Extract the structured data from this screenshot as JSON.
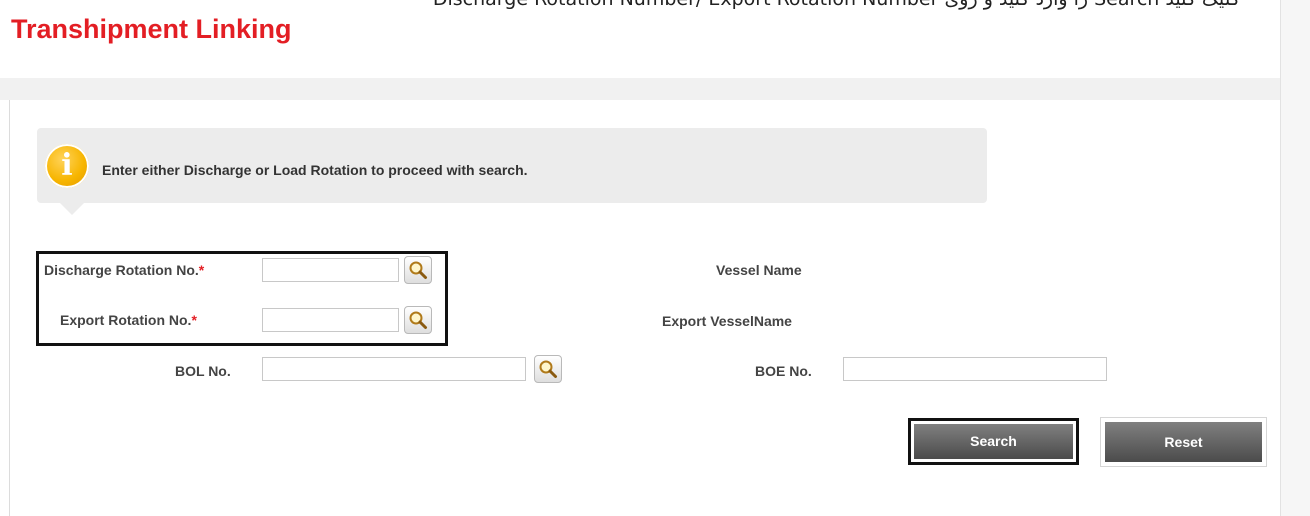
{
  "top_caption": "Discharge Rotation Number/ Export Rotation Number را وارد کنید و روی  Search کلیک کنید",
  "page_title": "Transhipment Linking",
  "info": {
    "icon": "info-icon",
    "icon_glyph": "i",
    "message": "Enter either Discharge or Load Rotation to proceed with search."
  },
  "form": {
    "discharge_rotation": {
      "label": "Discharge Rotation No.",
      "required_mark": "*",
      "value": ""
    },
    "export_rotation": {
      "label": "Export Rotation No.",
      "required_mark": "*",
      "value": ""
    },
    "bol": {
      "label": "BOL No.",
      "value": ""
    },
    "vessel_name": {
      "label": "Vessel Name"
    },
    "export_vessel_name": {
      "label": "Export VesselName"
    },
    "boe": {
      "label": "BOE No.",
      "value": ""
    }
  },
  "buttons": {
    "search": "Search",
    "reset": "Reset"
  },
  "colors": {
    "title": "#e31e24",
    "info_bubble": "#ececec",
    "info_icon": "#f7b500",
    "button": "#5f5f5f"
  }
}
